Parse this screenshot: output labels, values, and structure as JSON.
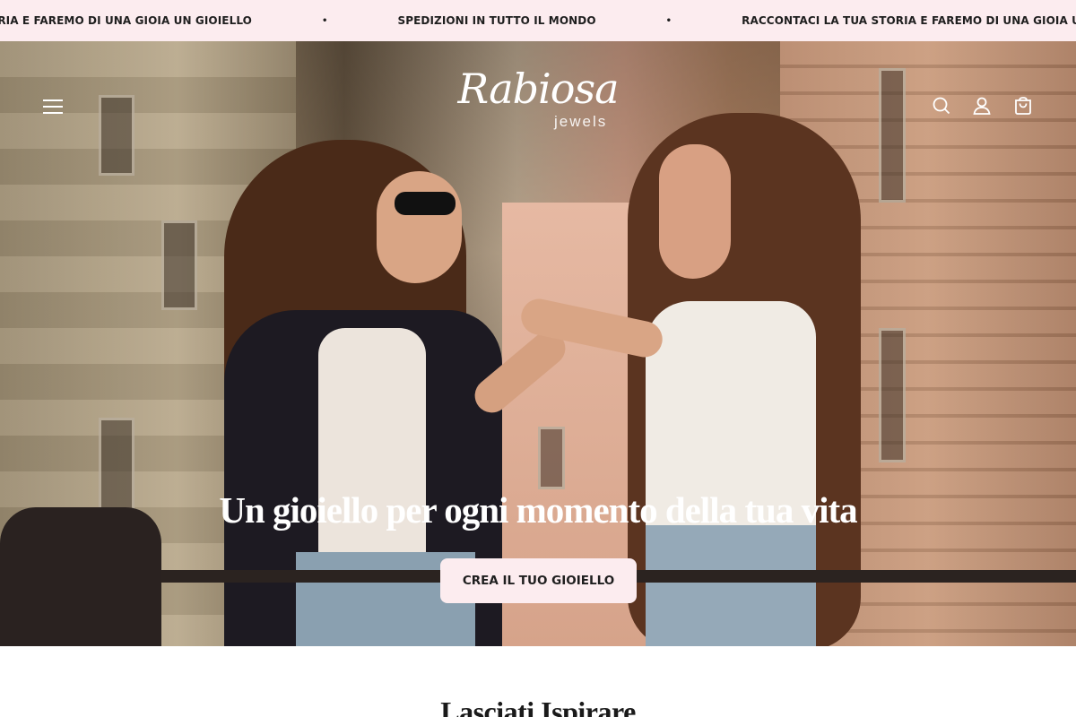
{
  "announcement": {
    "items": [
      "STORIA E FAREMO DI UNA GIOIA UN GIOIELLO",
      "•",
      "SPEDIZIONI IN TUTTO IL MONDO",
      "•",
      "RACCONTACI LA TUA STORIA E FAREMO DI UNA GIOIA UN GIOIELLO"
    ],
    "background": "#fcecef"
  },
  "header": {
    "logo_main": "Rabiosa",
    "logo_sub": "jewels",
    "icons": [
      "menu-icon",
      "search-icon",
      "account-icon",
      "cart-icon"
    ]
  },
  "hero": {
    "title": "Un gioiello per ogni momento della tua vita",
    "cta_label": "CREA IL TUO GIOIELLO",
    "cta_color": "#fcecef"
  },
  "section": {
    "title": "Lasciati Ispirare"
  }
}
